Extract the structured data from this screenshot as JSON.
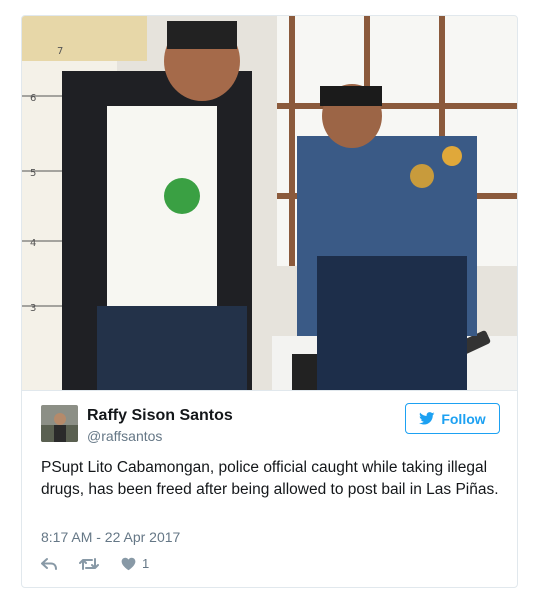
{
  "media": {
    "alt": "Tweet photo"
  },
  "author": {
    "display_name": "Raffy Sison Santos",
    "handle": "@raffsantos"
  },
  "follow_button": {
    "label": "Follow"
  },
  "tweet": {
    "text": "PSupt Lito Cabamongan, police official caught while taking illegal drugs, has been freed after being allowed to post bail in Las Piñas.",
    "timestamp": "8:17 AM - 22 Apr 2017"
  },
  "actions": {
    "like_count": "1"
  },
  "icons": {
    "reply": "reply-icon",
    "retweet": "retweet-icon",
    "like": "heart-icon",
    "follow": "twitter-bird-icon"
  },
  "colors": {
    "accent": "#1da1f2",
    "text": "#14171a",
    "muted": "#657786"
  }
}
